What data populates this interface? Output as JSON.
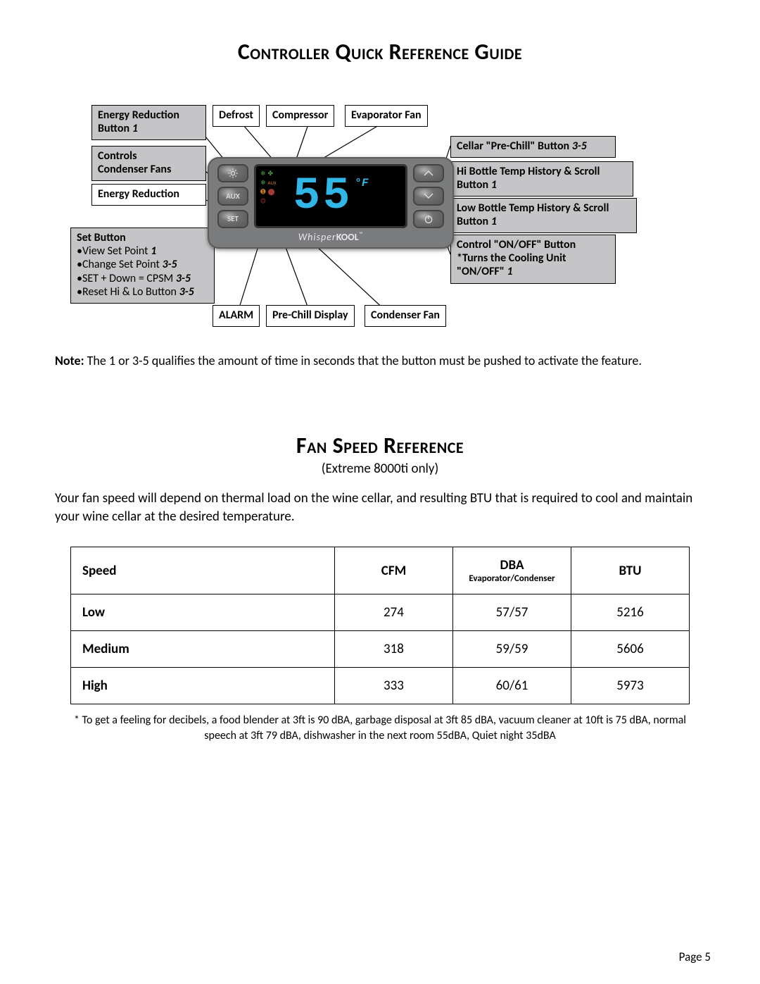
{
  "title1": "Controller Quick Reference Guide",
  "title2": "Fan Speed Reference",
  "subtitle2": "(Extreme 8000ti only)",
  "note_label": "Note:",
  "note_text": " The 1 or 3-5 qualifies the amount of time in seconds that the button must be pushed to activate the feature.",
  "fan_paragraph": "Your fan speed will depend on thermal load on the wine cellar, and resulting BTU that is required to cool and maintain your wine cellar at the desired temperature.",
  "footnote": "* To get a feeling for decibels, a food blender at 3ft is 90 dBA, garbage disposal at 3ft 85 dBA, vacuum cleaner at 10ft is 75 dBA, normal speech at 3ft 79 dBA, dishwasher in the next room 55dBA,  Quiet night 35dBA",
  "page": "Page 5",
  "device": {
    "brand_prefix": "Whisper",
    "brand_bold": "KOOL",
    "brand_tm": "™",
    "display_value": "55",
    "display_unit": "°F",
    "aux_label": "AUX",
    "set_label": "SET"
  },
  "callouts": {
    "energy_reduction_btn": {
      "title": "Energy Reduction Button",
      "time": "1"
    },
    "controls_condenser": {
      "line1": "Controls",
      "line2": "Condenser Fans"
    },
    "energy_reduction": "Energy Reduction",
    "set_button": {
      "heading": "Set Button",
      "l1": "•View Set Point",
      "t1": "1",
      "l2": "•Change Set Point",
      "t2": "3-5",
      "l3": "•SET + Down = CPSM",
      "t3": "3-5",
      "l4": "•Reset Hi & Lo Button",
      "t4": "3-5"
    },
    "defrost": "Defrost",
    "compressor": "Compressor",
    "evap_fan": "Evaporator Fan",
    "alarm": "ALARM",
    "prechill_display": "Pre-Chill Display",
    "condenser_fan": "Condenser Fan",
    "prechill_btn": {
      "title": "Cellar \"Pre-Chill\" Button",
      "time": "3-5"
    },
    "hi_bottle": {
      "title": "Hi Bottle Temp History & Scroll Button",
      "time": "1"
    },
    "lo_bottle": {
      "title": "Low Bottle Temp History & Scroll Button",
      "time": "1"
    },
    "onoff": {
      "l1": "Control \"ON/OFF\" Button",
      "l2": "*Turns the Cooling Unit",
      "l3": "\"ON/OFF\"",
      "t3": "1"
    }
  },
  "table": {
    "headers": {
      "speed": "Speed",
      "cfm": "CFM",
      "dba": "DBA",
      "dba_sub": "Evaporator/Condenser",
      "btu": "BTU"
    },
    "rows": [
      {
        "speed": "Low",
        "cfm": "274",
        "dba": "57/57",
        "btu": "5216"
      },
      {
        "speed": "Medium",
        "cfm": "318",
        "dba": "59/59",
        "btu": "5606"
      },
      {
        "speed": "High",
        "cfm": "333",
        "dba": "60/61",
        "btu": "5973"
      }
    ]
  }
}
